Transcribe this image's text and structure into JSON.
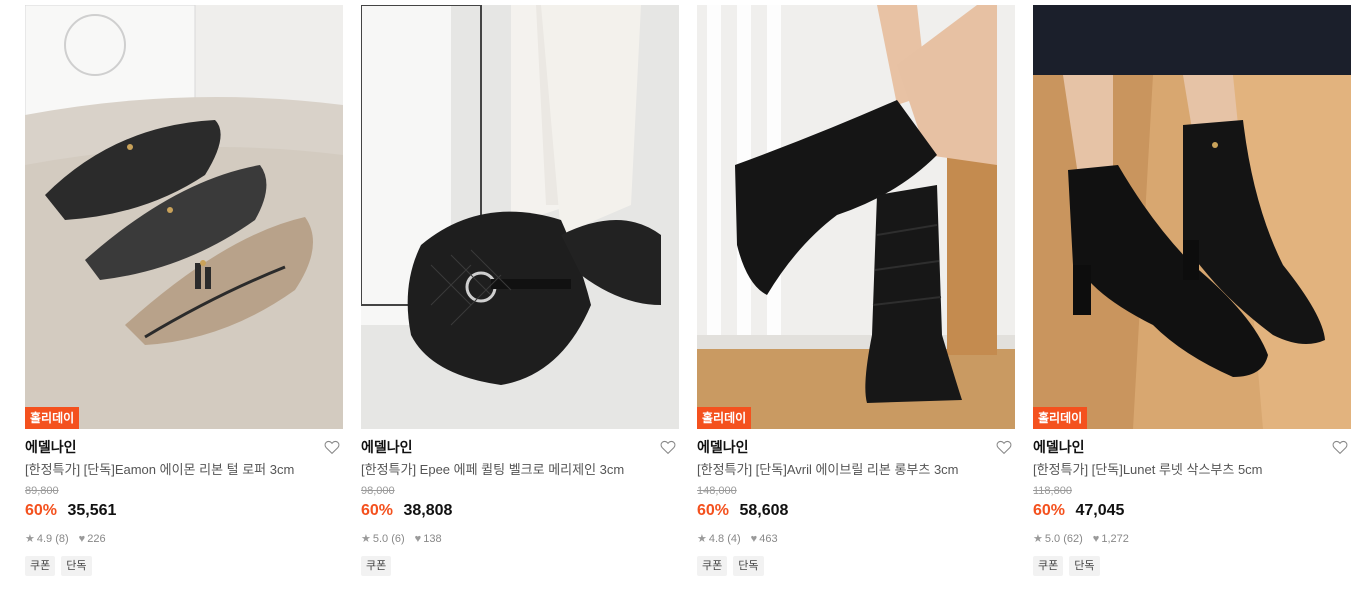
{
  "products": [
    {
      "badge": "홀리데이",
      "brand": "에델나인",
      "name": "[한정특가] [단독]Eamon 에이몬 리본 털 로퍼 3cm",
      "original_price": "89,800",
      "discount_rate": "60%",
      "sale_price": "35,561",
      "rating": "4.9 (8)",
      "likes": "226",
      "tags": [
        "쿠폰",
        "단독"
      ]
    },
    {
      "badge": "",
      "brand": "에델나인",
      "name": "[한정특가] Epee 에페 퀼팅 벨크로 메리제인 3cm",
      "original_price": "98,000",
      "discount_rate": "60%",
      "sale_price": "38,808",
      "rating": "5.0 (6)",
      "likes": "138",
      "tags": [
        "쿠폰"
      ]
    },
    {
      "badge": "홀리데이",
      "brand": "에델나인",
      "name": "[한정특가] [단독]Avril 에이브릴 리본 롱부츠 3cm",
      "original_price": "148,000",
      "discount_rate": "60%",
      "sale_price": "58,608",
      "rating": "4.8 (4)",
      "likes": "463",
      "tags": [
        "쿠폰",
        "단독"
      ]
    },
    {
      "badge": "홀리데이",
      "brand": "에델나인",
      "name": "[한정특가] [단독]Lunet 루넷 삭스부츠 5cm",
      "original_price": "118,800",
      "discount_rate": "60%",
      "sale_price": "47,045",
      "rating": "5.0 (62)",
      "likes": "1,272",
      "tags": [
        "쿠폰",
        "단독"
      ]
    }
  ],
  "colors": {
    "accent": "#f4511e",
    "badge_bg": "#f4511e",
    "tag_bg": "#f2f2f2"
  },
  "icons": {
    "star": "star-icon",
    "heart": "heart-icon",
    "wishlist": "heart-outline-icon"
  },
  "photos": [
    "loafer-photo (black, grey, beige loafers on fluffy rug)",
    "maryjane-photo (quilted black mary jane with white socks)",
    "longboots-photo (black knee-high boots by stairs)",
    "sockboots-photo (black pointed sock boots on wood floor)"
  ]
}
